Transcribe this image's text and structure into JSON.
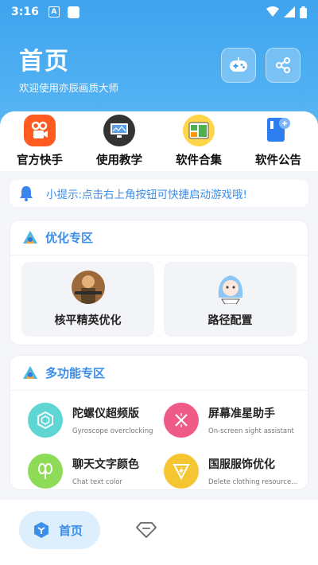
{
  "status": {
    "time": "3:16",
    "a_glyph": "A"
  },
  "header": {
    "title": "首页",
    "subtitle": "欢迎使用亦辰画质大师"
  },
  "quick_links": [
    {
      "label": "官方快手",
      "icon": "kuaishou-icon"
    },
    {
      "label": "使用教学",
      "icon": "tutorial-monitor-icon"
    },
    {
      "label": "软件合集",
      "icon": "app-collection-icon"
    },
    {
      "label": "软件公告",
      "icon": "announcement-icon"
    }
  ],
  "notice": {
    "text": "小提示:点击右上角按钮可快捷启动游戏哦!"
  },
  "optimize": {
    "title": "优化专区",
    "items": [
      {
        "label": "核平精英优化"
      },
      {
        "label": "路径配置"
      }
    ]
  },
  "multi": {
    "title": "多功能专区",
    "items": [
      {
        "title": "陀螺仪超频版",
        "subtitle": "Gyroscope overclocking",
        "color": "#5fd6d4"
      },
      {
        "title": "屏幕准星助手",
        "subtitle": "On-screen sight assistant",
        "color": "#f05a86"
      },
      {
        "title": "聊天文字颜色",
        "subtitle": "Chat text color",
        "color": "#8edb58"
      },
      {
        "title": "国服服饰优化",
        "subtitle": "Delete clothing resource...",
        "color": "#f6c532"
      }
    ]
  },
  "nav": {
    "home_label": "首页"
  },
  "colors": {
    "accent": "#3b8eea",
    "header": "#4aabf0"
  }
}
